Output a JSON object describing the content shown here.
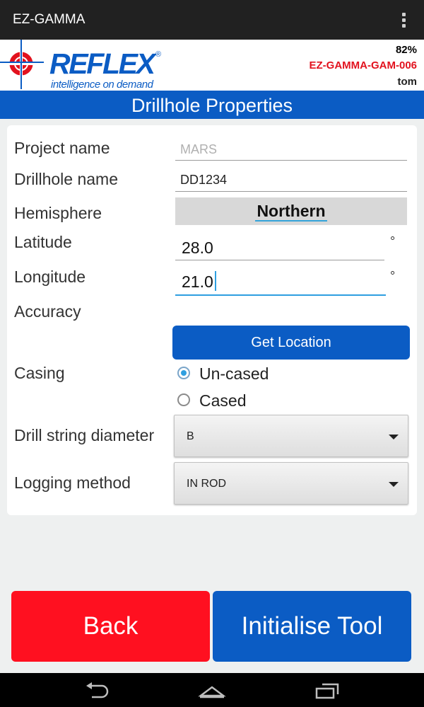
{
  "app": {
    "title": "EZ-GAMMA"
  },
  "header": {
    "brand_logo": "REFLEX",
    "brand_tagline": "intelligence on demand",
    "battery": "82%",
    "device_id": "EZ-GAMMA-GAM-006",
    "user": "tom"
  },
  "page": {
    "title": "Drillhole Properties"
  },
  "form": {
    "project_name": {
      "label": "Project name",
      "placeholder": "MARS"
    },
    "drillhole_name": {
      "label": "Drillhole name",
      "value": "DD1234"
    },
    "hemisphere": {
      "label": "Hemisphere",
      "value": "Northern"
    },
    "latitude": {
      "label": "Latitude",
      "value": "28.0",
      "unit": "°"
    },
    "longitude": {
      "label": "Longitude",
      "value": "21.0",
      "unit": "°"
    },
    "accuracy": {
      "label": "Accuracy"
    },
    "get_location_label": "Get Location",
    "casing": {
      "label": "Casing",
      "options": [
        {
          "label": "Un-cased",
          "selected": true
        },
        {
          "label": "Cased",
          "selected": false
        }
      ]
    },
    "drill_string_diameter": {
      "label": "Drill string diameter",
      "value": "B"
    },
    "logging_method": {
      "label": "Logging method",
      "value": "IN ROD"
    }
  },
  "buttons": {
    "back": "Back",
    "initialise": "Initialise Tool"
  },
  "colors": {
    "action_bar": "#212121",
    "accent_blue": "#0b5cc4",
    "back_red": "#ff1020",
    "device_id_red": "#e2121e",
    "focus_blue": "#2f9fe0"
  },
  "icons": {
    "overflow": "overflow-menu-icon",
    "nav": [
      "back-icon",
      "home-icon",
      "recent-apps-icon"
    ]
  }
}
